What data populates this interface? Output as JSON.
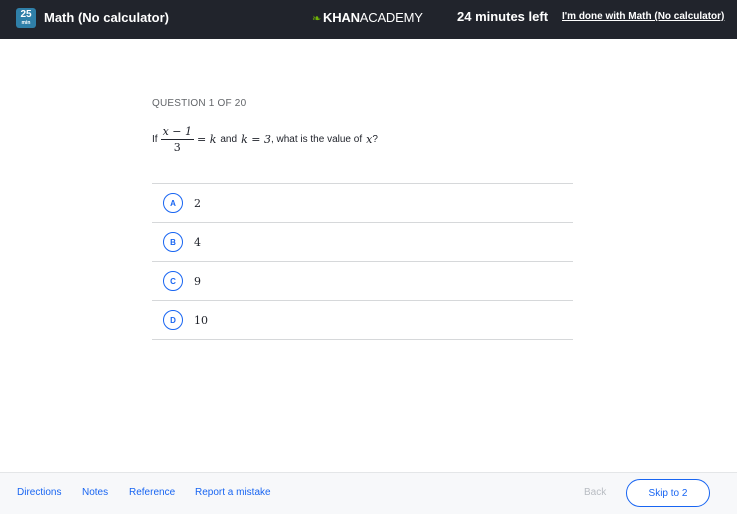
{
  "header": {
    "badge_number": "25",
    "badge_unit": "min",
    "title": "Math (No calculator)",
    "logo_bold": "KHAN",
    "logo_light": "ACADEMY",
    "timer": "24 minutes left",
    "done_link": "I'm done with Math (No calculator)"
  },
  "question": {
    "counter": "QUESTION 1 OF 20",
    "prompt": {
      "if": "If",
      "frac_numerator": "x − 1",
      "frac_denominator": "3",
      "eq_k": "= k",
      "and": "and",
      "k_eq": "k = 3",
      "tail": ", what is the value of",
      "var": "x",
      "qmark": "?"
    },
    "choices": [
      {
        "letter": "A",
        "value": "2"
      },
      {
        "letter": "B",
        "value": "4"
      },
      {
        "letter": "C",
        "value": "9"
      },
      {
        "letter": "D",
        "value": "10"
      }
    ]
  },
  "footer": {
    "directions": "Directions",
    "notes": "Notes",
    "reference": "Reference",
    "report": "Report a mistake",
    "back": "Back",
    "skip": "Skip to 2"
  },
  "colors": {
    "header_bg": "#21242c",
    "accent_blue": "#1865f2",
    "leaf_green": "#71b307"
  },
  "icons": {
    "logo_leaf": "leaf-icon"
  }
}
